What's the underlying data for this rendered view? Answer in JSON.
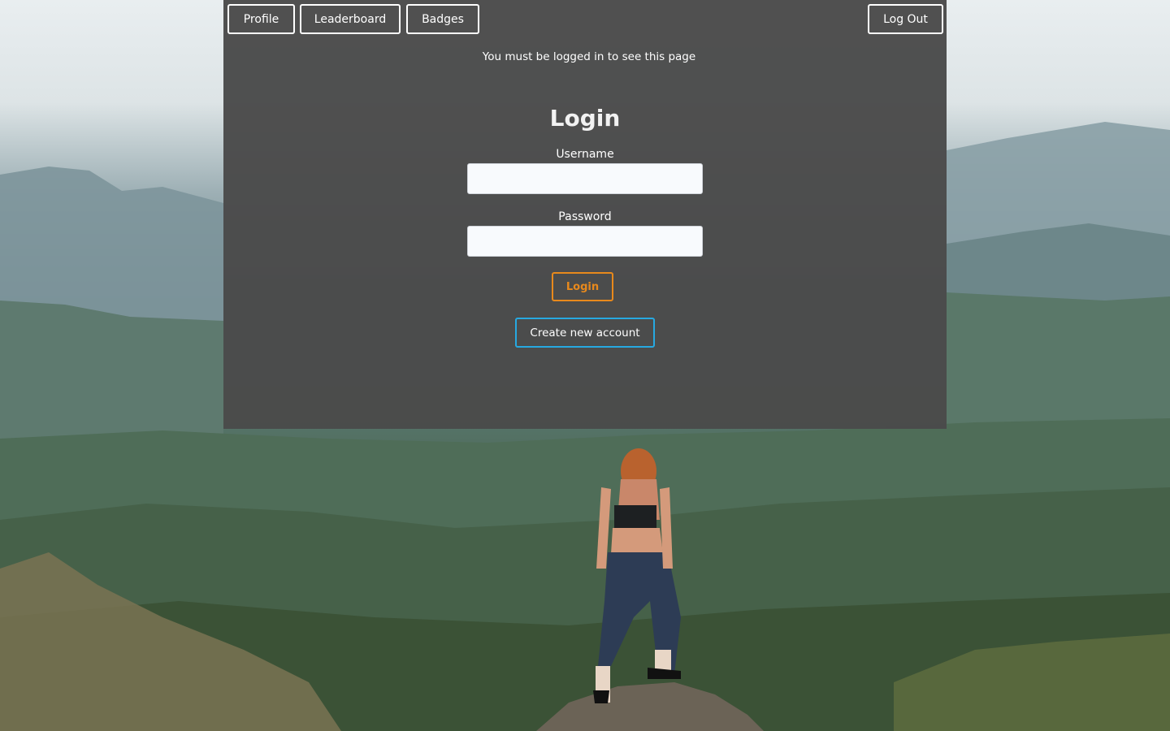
{
  "nav": {
    "profile_label": "Profile",
    "leaderboard_label": "Leaderboard",
    "badges_label": "Badges",
    "logout_label": "Log Out"
  },
  "notice": "You must be logged in to see this page",
  "login_form": {
    "title": "Login",
    "username_label": "Username",
    "username_value": "",
    "password_label": "Password",
    "password_value": "",
    "submit_label": "Login",
    "create_account_label": "Create new account"
  },
  "colors": {
    "panel_bg": "#4a4a4a",
    "login_accent": "#e8891c",
    "create_accent": "#27a9e1"
  }
}
